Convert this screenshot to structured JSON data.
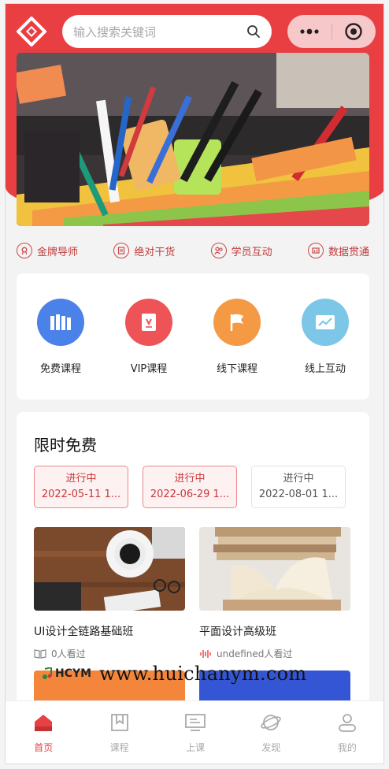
{
  "header": {
    "search_placeholder": "输入搜索关键词"
  },
  "features": [
    {
      "label": "金牌导师",
      "icon": "medal-icon"
    },
    {
      "label": "绝对干货",
      "icon": "notebook-icon"
    },
    {
      "label": "学员互动",
      "icon": "users-icon"
    },
    {
      "label": "数据贯通",
      "icon": "data-icon"
    }
  ],
  "categories": [
    {
      "label": "免费课程",
      "icon": "books-icon",
      "color": "#4a82ea"
    },
    {
      "label": "VIP课程",
      "icon": "vip-book-icon",
      "color": "#ee5457"
    },
    {
      "label": "线下课程",
      "icon": "flag-icon",
      "color": "#f49a45"
    },
    {
      "label": "线上互动",
      "icon": "chart-screen-icon",
      "color": "#7cc6e8"
    }
  ],
  "free_section": {
    "title": "限时免费",
    "sessions": [
      {
        "status": "进行中",
        "date": "2022-05-11 1...",
        "state": "active"
      },
      {
        "status": "进行中",
        "date": "2022-06-29 1...",
        "state": "active"
      },
      {
        "status": "进行中",
        "date": "2022-08-01 1...",
        "state": "inactive"
      }
    ],
    "courses": [
      {
        "title": "UI设计全链路基础班",
        "views": "0人看过",
        "icon": "book-open-icon"
      },
      {
        "title": "平面设计高级班",
        "views": "undefined人看过",
        "icon": "sound-wave-icon"
      }
    ],
    "price_fragment": "¥"
  },
  "watermark": {
    "logo_text": "HCYM",
    "url": "www.huichanym.com"
  },
  "tabbar": [
    {
      "label": "首页",
      "icon": "home-icon",
      "active": true
    },
    {
      "label": "课程",
      "icon": "bookmark-icon",
      "active": false
    },
    {
      "label": "上课",
      "icon": "monitor-icon",
      "active": false
    },
    {
      "label": "发现",
      "icon": "planet-icon",
      "active": false
    },
    {
      "label": "我的",
      "icon": "user-icon",
      "active": false
    }
  ],
  "colors": {
    "brand_red": "#ea3f42",
    "accent_red": "#e84144"
  }
}
